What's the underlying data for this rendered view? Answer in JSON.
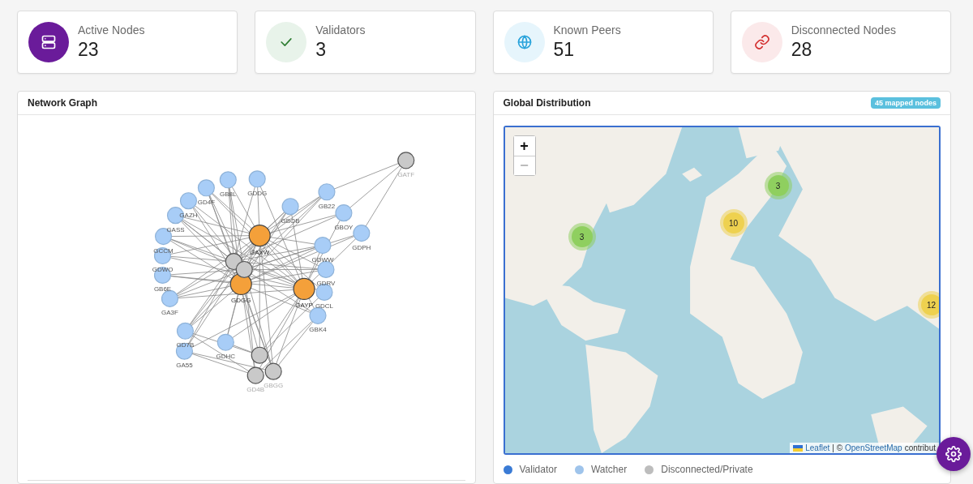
{
  "stats": [
    {
      "kind": "nodes",
      "label": "Active Nodes",
      "value": "23"
    },
    {
      "kind": "validators",
      "label": "Validators",
      "value": "3"
    },
    {
      "kind": "peers",
      "label": "Known Peers",
      "value": "51"
    },
    {
      "kind": "disconnected",
      "label": "Disconnected Nodes",
      "value": "28"
    }
  ],
  "network_graph": {
    "title": "Network Graph",
    "nodes": [
      {
        "kind": "watcher",
        "label": "GD4F"
      },
      {
        "kind": "watcher",
        "label": "GB8L"
      },
      {
        "kind": "watcher",
        "label": "GDDG"
      },
      {
        "kind": "watcher",
        "label": "GAZH"
      },
      {
        "kind": "watcher",
        "label": "GASS"
      },
      {
        "kind": "watcher",
        "label": "GCCM"
      },
      {
        "kind": "watcher",
        "label": "GDWO"
      },
      {
        "kind": "watcher",
        "label": "GB6E"
      },
      {
        "kind": "watcher",
        "label": "GA3F"
      },
      {
        "kind": "watcher",
        "label": "GD7B"
      },
      {
        "kind": "watcher",
        "label": "GA55"
      },
      {
        "kind": "watcher",
        "label": "GDHC"
      },
      {
        "kind": "watcher",
        "label": "GBOB"
      },
      {
        "kind": "watcher",
        "label": "GB22"
      },
      {
        "kind": "watcher",
        "label": "GBOY"
      },
      {
        "kind": "watcher",
        "label": "GDPH"
      },
      {
        "kind": "watcher",
        "label": "GDWW"
      },
      {
        "kind": "watcher",
        "label": "GDRV"
      },
      {
        "kind": "watcher",
        "label": "GDCL"
      },
      {
        "kind": "watcher",
        "label": "GBK4"
      },
      {
        "kind": "validator",
        "label": "GAXW"
      },
      {
        "kind": "validator",
        "label": "GDGG"
      },
      {
        "kind": "validator",
        "label": "GAYP"
      },
      {
        "kind": "disconnected",
        "label": "GATF"
      },
      {
        "kind": "disconnected"
      },
      {
        "kind": "disconnected"
      },
      {
        "kind": "disconnected"
      },
      {
        "kind": "disconnected",
        "label": "GD4B"
      },
      {
        "kind": "disconnected",
        "label": "GBGG"
      }
    ]
  },
  "global_distribution": {
    "title": "Global Distribution",
    "badge": "45 mapped nodes",
    "zoom_in": "+",
    "zoom_out": "−",
    "clusters": [
      {
        "count": "3",
        "color": "#8fcf5f"
      },
      {
        "count": "10",
        "color": "#eed14f"
      },
      {
        "count": "3",
        "color": "#8fcf5f"
      },
      {
        "count": "12",
        "color": "#eed14f"
      }
    ],
    "attribution": {
      "leaflet": "Leaflet",
      "separator": "| ©",
      "osm": "OpenStreetMap",
      "rest": "contribut"
    },
    "legend": [
      {
        "label": "Validator",
        "color": "#3a7bd5"
      },
      {
        "label": "Watcher",
        "color": "#9fc4eb"
      },
      {
        "label": "Disconnected/Private",
        "color": "#bdbdbd"
      }
    ]
  }
}
